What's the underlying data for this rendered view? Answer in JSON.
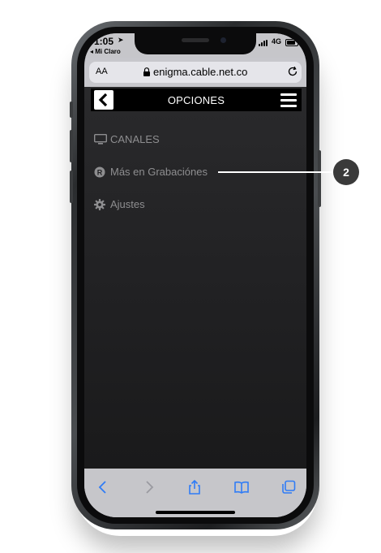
{
  "status_bar": {
    "time": "1:05",
    "back_app": "◂ Mi Claro",
    "network": "4G"
  },
  "browser": {
    "text_size_label": "AA",
    "url": "enigma.cable.net.co",
    "toolbar_icons": [
      "back-icon",
      "forward-icon",
      "share-icon",
      "bookmarks-icon",
      "tabs-icon"
    ]
  },
  "app": {
    "header_title": "OPCIONES",
    "menu": [
      {
        "label": "CANALES",
        "icon": "tv-icon"
      },
      {
        "label": "Más en Grabaciónes",
        "icon": "recordings-icon"
      },
      {
        "label": "Ajustes",
        "icon": "gear-icon"
      }
    ]
  },
  "callout": {
    "number": "2"
  },
  "colors": {
    "app_background": "#222224",
    "header_background": "#000000",
    "menu_text": "#8e8e90",
    "browser_chrome": "#c6c6ca",
    "callout_badge": "#3a3a3a",
    "toolbar_icons": "#2f7cf6"
  }
}
